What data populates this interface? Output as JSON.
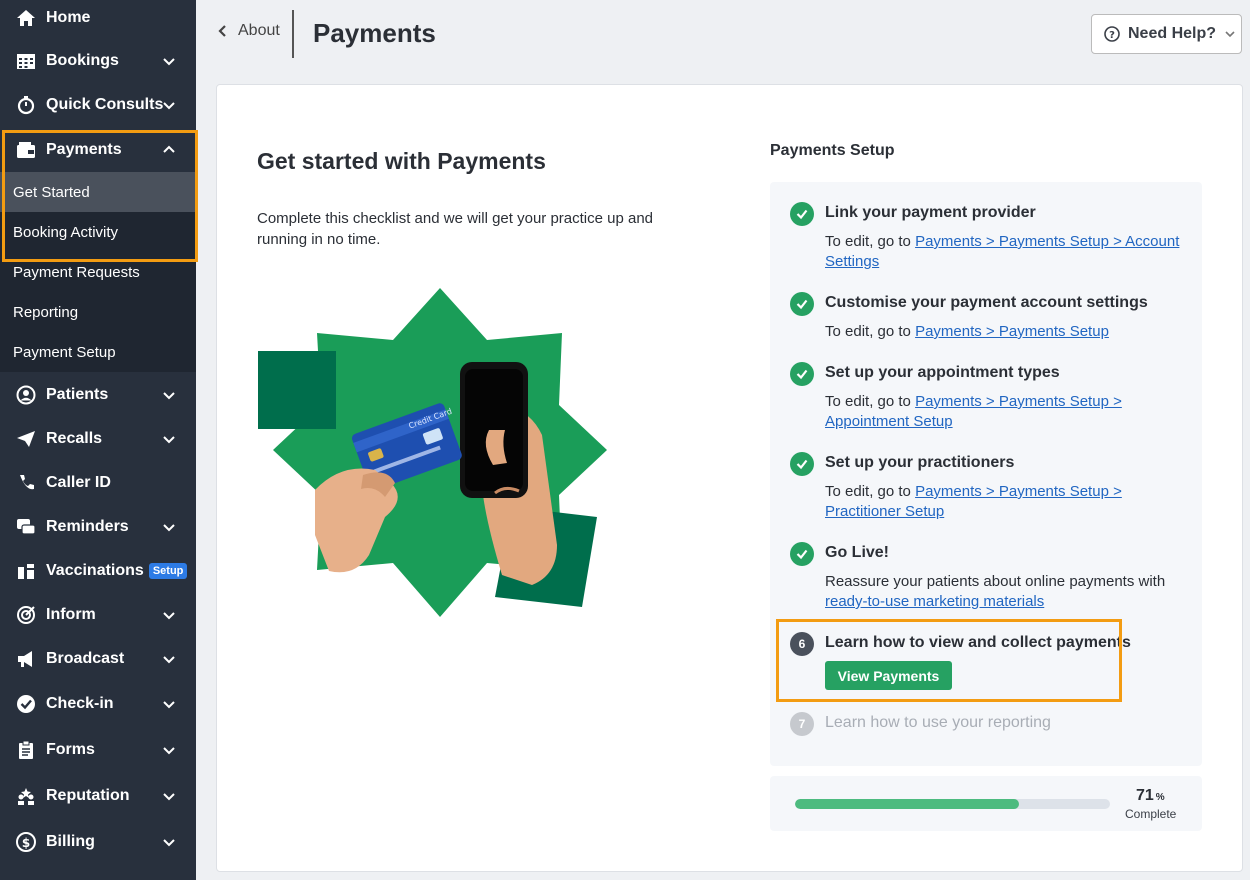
{
  "sidebar": {
    "items": [
      {
        "label": "Home",
        "icon": "home-icon"
      },
      {
        "label": "Bookings",
        "icon": "calendar-grid-icon"
      },
      {
        "label": "Quick Consults",
        "icon": "stopwatch-icon"
      },
      {
        "label": "Payments",
        "icon": "wallet-icon"
      },
      {
        "label": "Patients",
        "icon": "user-circle-icon"
      },
      {
        "label": "Recalls",
        "icon": "paper-plane-icon"
      },
      {
        "label": "Caller ID",
        "icon": "phone-icon"
      },
      {
        "label": "Reminders",
        "icon": "chat-icon"
      },
      {
        "label": "Vaccinations",
        "icon": "vials-icon",
        "badge": "Setup"
      },
      {
        "label": "Inform",
        "icon": "target-icon"
      },
      {
        "label": "Broadcast",
        "icon": "megaphone-icon"
      },
      {
        "label": "Check-in",
        "icon": "check-badge-icon"
      },
      {
        "label": "Forms",
        "icon": "clipboard-icon"
      },
      {
        "label": "Reputation",
        "icon": "people-star-icon"
      },
      {
        "label": "Billing",
        "icon": "dollar-icon"
      }
    ],
    "payments_sub": [
      {
        "label": "Get Started",
        "active": true
      },
      {
        "label": "Booking Activity"
      },
      {
        "label": "Payment Requests"
      },
      {
        "label": "Reporting"
      },
      {
        "label": "Payment Setup"
      }
    ]
  },
  "header": {
    "back_label": "About",
    "title": "Payments",
    "help_label": "Need Help?"
  },
  "hero": {
    "title": "Get started with Payments",
    "description": "Complete this checklist and we will get your practice up and running in no time.",
    "card_text": "Credit Card"
  },
  "setup": {
    "title": "Payments Setup",
    "steps": [
      {
        "title": "Link your payment provider",
        "prefix": "To edit, go to ",
        "link": "Payments > Payments Setup > Account Settings",
        "done": true
      },
      {
        "title": "Customise your payment account settings",
        "prefix": "To edit, go to ",
        "link": "Payments > Payments Setup",
        "done": true
      },
      {
        "title": "Set up your appointment types",
        "prefix": "To edit, go to ",
        "link": "Payments > Payments Setup > Appointment Setup",
        "done": true
      },
      {
        "title": "Set up your practitioners",
        "prefix": "To edit, go to ",
        "link": "Payments > Payments Setup > Practitioner Setup",
        "done": true
      },
      {
        "title": "Go Live!",
        "prefix": "Reassure your patients about online payments with ",
        "link": "ready-to-use marketing materials",
        "done": true
      },
      {
        "number": "6",
        "title": "Learn how to view and collect payments",
        "button": "View Payments"
      },
      {
        "number": "7",
        "title": "Learn how to use your reporting"
      }
    ]
  },
  "progress": {
    "value": 71,
    "unit": "%",
    "label": "Complete"
  },
  "colors": {
    "sidebar_bg": "#28303d",
    "accent_green": "#26a162",
    "highlight_orange": "#f39c12",
    "link_blue": "#2166c2"
  }
}
